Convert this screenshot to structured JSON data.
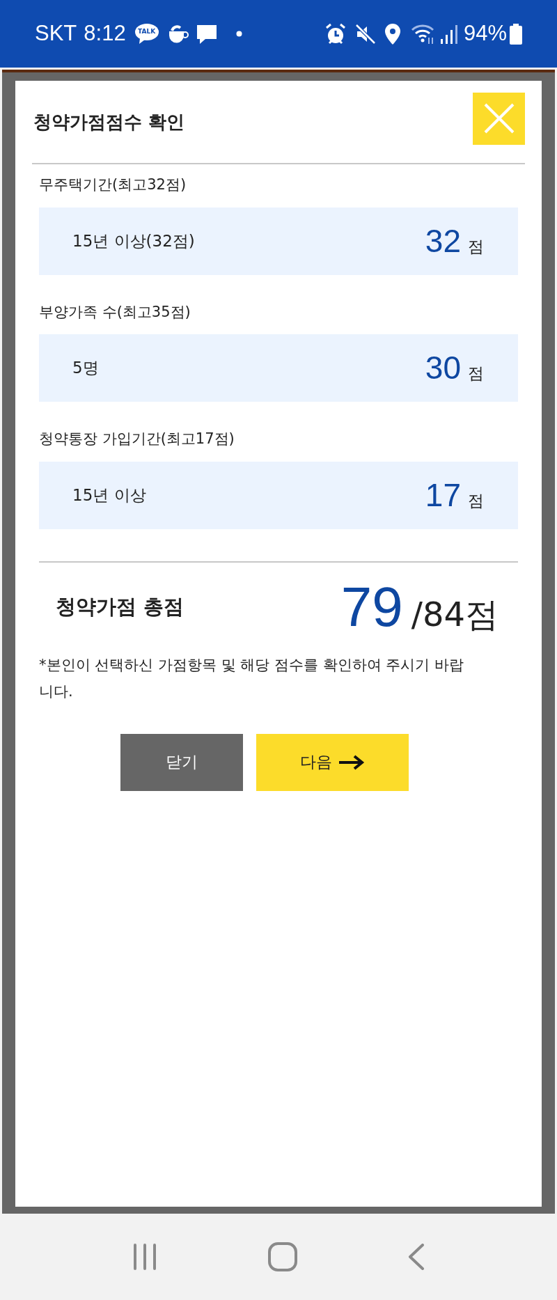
{
  "status_bar": {
    "carrier": "SKT",
    "time": "8:12",
    "talk_badge": "TALK",
    "battery": "94%"
  },
  "dialog": {
    "title": "청약가점점수 확인",
    "sections": [
      {
        "label": "무주택기간(최고32점)",
        "choice": "15년 이상(32점)",
        "score": "32",
        "unit": "점"
      },
      {
        "label": "부양가족 수(최고35점)",
        "choice": "5명",
        "score": "30",
        "unit": "점"
      },
      {
        "label": "청약통장 가입기간(최고17점)",
        "choice": "15년 이상",
        "score": "17",
        "unit": "점"
      }
    ],
    "total": {
      "label": "청약가점 총점",
      "score": "79",
      "max": "/84점"
    },
    "note": "*본인이 선택하신 가점항목 및 해당 점수를 확인하여 주시기 바랍니다.",
    "buttons": [
      {
        "label": "닫기",
        "kind": "secondary"
      },
      {
        "label": "다음",
        "kind": "primary"
      }
    ]
  }
}
